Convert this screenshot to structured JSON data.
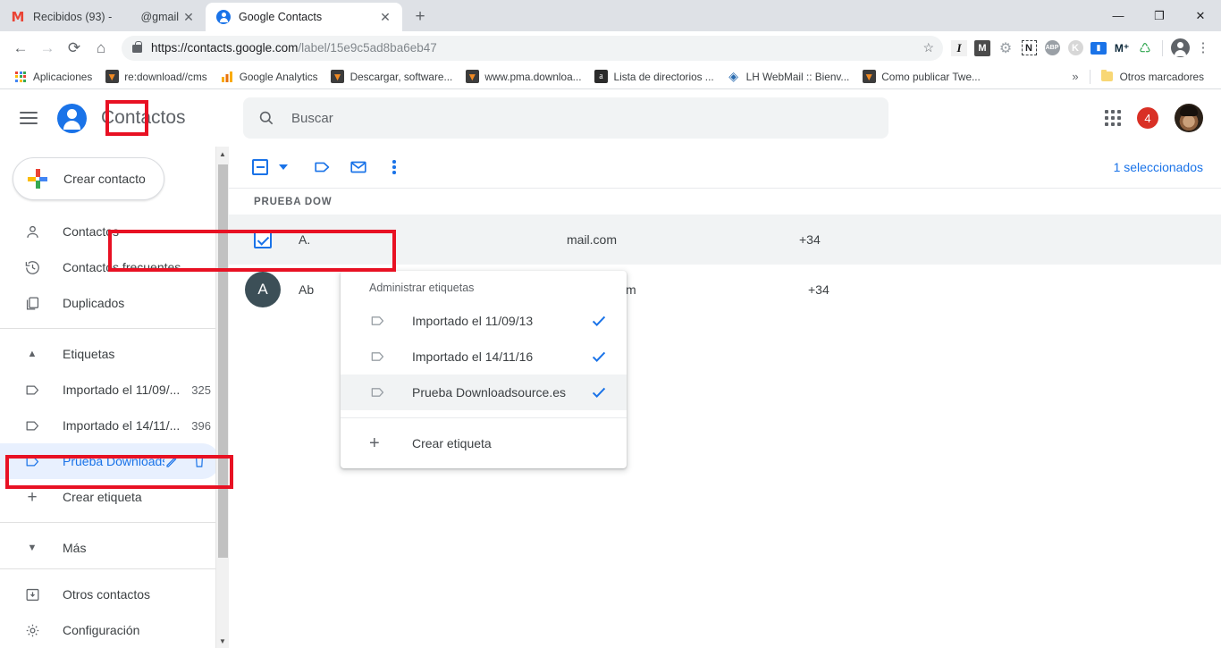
{
  "browser": {
    "tabs": [
      {
        "title": "Recibidos (93) -",
        "title_fragment": "@gmail",
        "favicon": "gmail-icon",
        "active": false
      },
      {
        "title": "Google Contacts",
        "title_fragment": "",
        "favicon": "google-contacts-icon",
        "active": true
      }
    ],
    "new_tab_label": "+",
    "window_controls": {
      "minimize": "—",
      "maximize": "❐",
      "close": "✕"
    },
    "nav": {
      "back": "←",
      "forward": "→",
      "reload": "⟳",
      "home": "⌂"
    },
    "url": {
      "scheme_host": "https://contacts.google.com",
      "path": "/label/15e9c5ad8ba6eb47"
    },
    "star_label": "☆",
    "extensions": [
      {
        "name": "italic-extension-icon",
        "glyph": "I"
      },
      {
        "name": "mailtrack-extension-icon",
        "glyph": "M"
      },
      {
        "name": "gear-extension-icon",
        "glyph": "⚙"
      },
      {
        "name": "nimbus-extension-icon",
        "glyph": "N"
      },
      {
        "name": "adblock-plus-extension-icon",
        "glyph": "ABP"
      },
      {
        "name": "kaspersky-extension-icon",
        "glyph": "K"
      },
      {
        "name": "evernote-extension-icon",
        "glyph": "▤"
      },
      {
        "name": "movistar-extension-icon",
        "glyph": "M"
      },
      {
        "name": "avast-extension-icon",
        "glyph": "⛨"
      }
    ],
    "bookmarks": [
      {
        "label": "Aplicaciones",
        "icon": "apps-grid-icon"
      },
      {
        "label": "re:download//cms",
        "icon": "downloadsource-icon"
      },
      {
        "label": "Google Analytics",
        "icon": "analytics-icon"
      },
      {
        "label": "Descargar, software...",
        "icon": "downloadsource-icon"
      },
      {
        "label": "www.pma.downloa...",
        "icon": "downloadsource-icon"
      },
      {
        "label": "Lista de directorios ...",
        "icon": "amazon-icon"
      },
      {
        "label": "LH WebMail :: Bienv...",
        "icon": "webmail-icon"
      },
      {
        "label": "Como publicar Twe...",
        "icon": "downloadsource-icon"
      }
    ],
    "bookmarks_overflow": "»",
    "other_bookmarks": "Otros marcadores"
  },
  "app": {
    "title": "Contactos",
    "menu_icon_label": "hamburger-menu",
    "create_contact": "Crear contacto",
    "search": {
      "placeholder": "Buscar",
      "value": ""
    },
    "notifications_count": "4",
    "nav_items": [
      {
        "label": "Contactos",
        "icon": "person-icon"
      },
      {
        "label": "Contactos frecuentes",
        "icon": "history-icon"
      },
      {
        "label": "Duplicados",
        "icon": "duplicate-icon"
      }
    ],
    "labels_section": {
      "header": "Etiquetas",
      "collapse_icon": "chevron-up-icon",
      "items": [
        {
          "label": "Importado el 11/09/...",
          "count": "325",
          "selected": false
        },
        {
          "label": "Importado el 14/11/...",
          "count": "396",
          "selected": false
        },
        {
          "label": "Prueba Downloadsource.es",
          "count": "",
          "selected": true,
          "edit_icon": "pencil-icon",
          "delete_icon": "trash-icon"
        }
      ],
      "create_label": "Crear etiqueta"
    },
    "more_section": {
      "label": "Más",
      "icon": "chevron-down-icon"
    },
    "bottom_items": [
      {
        "label": "Otros contactos",
        "icon": "other-contacts-icon"
      },
      {
        "label": "Configuración",
        "icon": "gear-icon"
      }
    ]
  },
  "toolbar": {
    "select_all_label": "checkbox-indeterminate",
    "dropdown_caret": "caret-down-icon",
    "manage_labels_label": "label-icon",
    "email_label": "email-icon",
    "more_actions_label": "more-vertical-icon",
    "selected_count": "1 seleccionados"
  },
  "list": {
    "group_header": "PRUEBA DOW",
    "columns": [
      "name",
      "email",
      "phone"
    ],
    "rows": [
      {
        "selected": true,
        "avatar_letter": "",
        "name": "A.",
        "email": "mail.com",
        "phone": "+34"
      },
      {
        "selected": false,
        "avatar_letter": "A",
        "name": "Ab",
        "email": "otmail.com",
        "phone": "+34"
      }
    ]
  },
  "dropdown": {
    "title": "Administrar etiquetas",
    "items": [
      {
        "label": "Importado el 11/09/13",
        "checked": true,
        "highlighted": false
      },
      {
        "label": "Importado el 14/11/16",
        "checked": true,
        "highlighted": false
      },
      {
        "label": "Prueba Downloadsource.es",
        "checked": true,
        "highlighted": true
      }
    ],
    "create_label": "Crear etiqueta"
  },
  "annotations": {
    "highlight_color": "#e81123",
    "boxes": [
      {
        "name": "manage-labels-button-highlight"
      },
      {
        "name": "dropdown-label-item-highlight"
      },
      {
        "name": "sidebar-label-highlight"
      }
    ]
  },
  "colors": {
    "accent_blue": "#1a73e8",
    "badge_red": "#d93025",
    "annotation_red": "#e81123",
    "selected_bg": "#e8f0fe"
  }
}
